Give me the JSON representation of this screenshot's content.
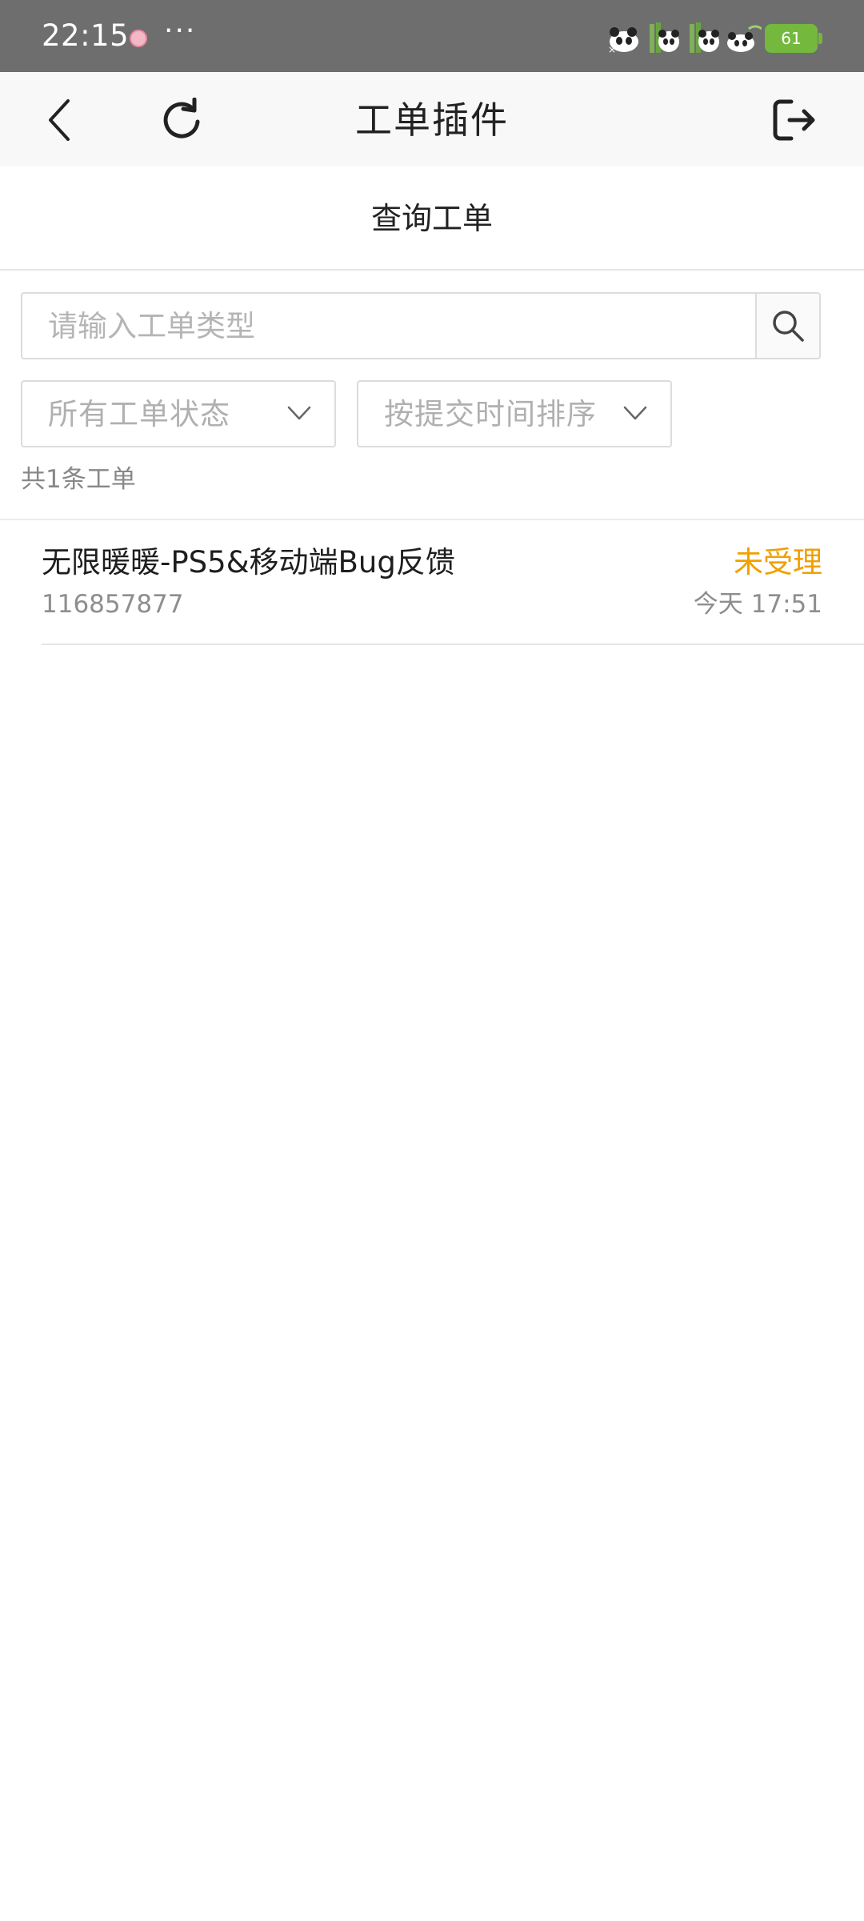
{
  "status_bar": {
    "time": "22:15",
    "dots": "···",
    "battery": "61",
    "notification_icon": "pink-app-notification-icon",
    "colors": {
      "background": "#6e6e6e",
      "battery": "#74b83e"
    }
  },
  "header": {
    "title": "工单插件",
    "icons": {
      "back": "chevron-left-icon",
      "refresh": "refresh-icon",
      "exit": "logout-icon"
    }
  },
  "tab": {
    "label": "查询工单"
  },
  "search": {
    "placeholder": "请输入工单类型",
    "value": "",
    "icon": "search-icon"
  },
  "filters": {
    "status": {
      "label": "所有工单状态"
    },
    "sort": {
      "label": "按提交时间排序"
    }
  },
  "list": {
    "count_text": "共1条工单",
    "items": [
      {
        "title": "无限暖暖-PS5&移动端Bug反馈",
        "id": "116857877",
        "status": "未受理",
        "time": "今天 17:51"
      }
    ]
  },
  "colors": {
    "accent_status": "#f0a000",
    "text_primary": "#222222",
    "text_secondary": "#8e8e8e"
  }
}
